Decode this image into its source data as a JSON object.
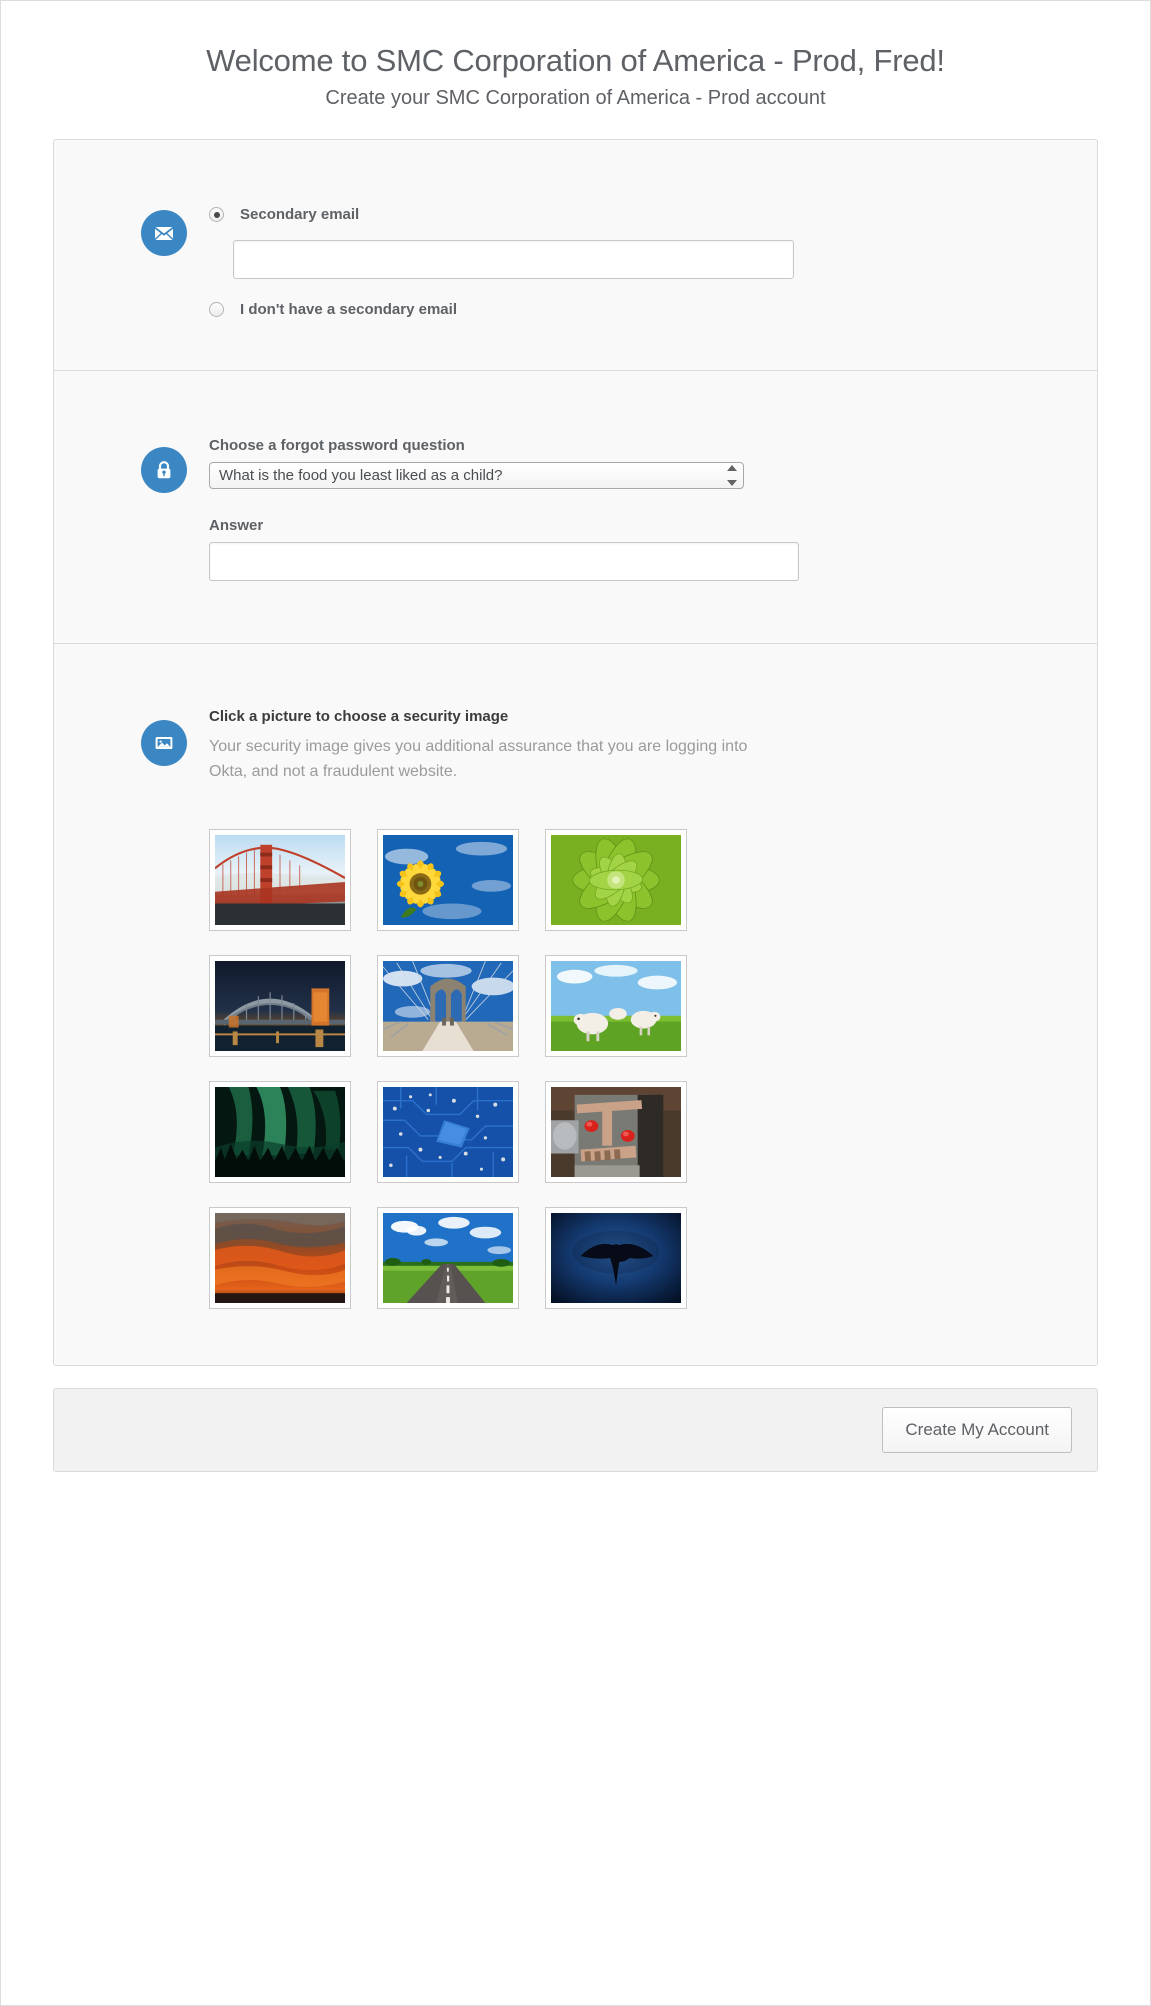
{
  "header": {
    "title": "Welcome to SMC Corporation of America - Prod, Fred!",
    "subtitle": "Create your SMC Corporation of America - Prod account"
  },
  "email_section": {
    "icon": "envelope-icon",
    "option_secondary_email": "Secondary email",
    "option_no_secondary_email": "I don't have a secondary email",
    "selected": "Secondary email",
    "email_value": "",
    "email_placeholder": ""
  },
  "password_section": {
    "icon": "lock-icon",
    "question_label": "Choose a forgot password question",
    "question_selected": "What is the food you least liked as a child?",
    "answer_label": "Answer",
    "answer_value": "",
    "answer_placeholder": ""
  },
  "security_image_section": {
    "icon": "picture-icon",
    "title": "Click a picture to choose a security image",
    "description": "Your security image gives you additional assurance that you are logging into Okta, and not a fraudulent website.",
    "thumbnails": [
      {
        "name": "golden-gate-bridge-in-fog"
      },
      {
        "name": "sunflower-against-blue-sky"
      },
      {
        "name": "green-succulent-plant"
      },
      {
        "name": "arch-bridge-at-night"
      },
      {
        "name": "brooklyn-bridge-walkway"
      },
      {
        "name": "lambs-in-green-field"
      },
      {
        "name": "aurora-borealis-over-forest"
      },
      {
        "name": "blue-circuit-board"
      },
      {
        "name": "toy-robot-face"
      },
      {
        "name": "red-sunset-clouds"
      },
      {
        "name": "road-through-green-fields"
      },
      {
        "name": "manta-ray-silhouette"
      }
    ]
  },
  "footer": {
    "submit_label": "Create My Account"
  },
  "colors": {
    "badge_blue": "#3b87c4",
    "text_gray": "#5e6165",
    "muted_gray": "#9b9b9b",
    "panel_bg": "#f9f9f9",
    "footer_bg": "#f2f2f2"
  }
}
